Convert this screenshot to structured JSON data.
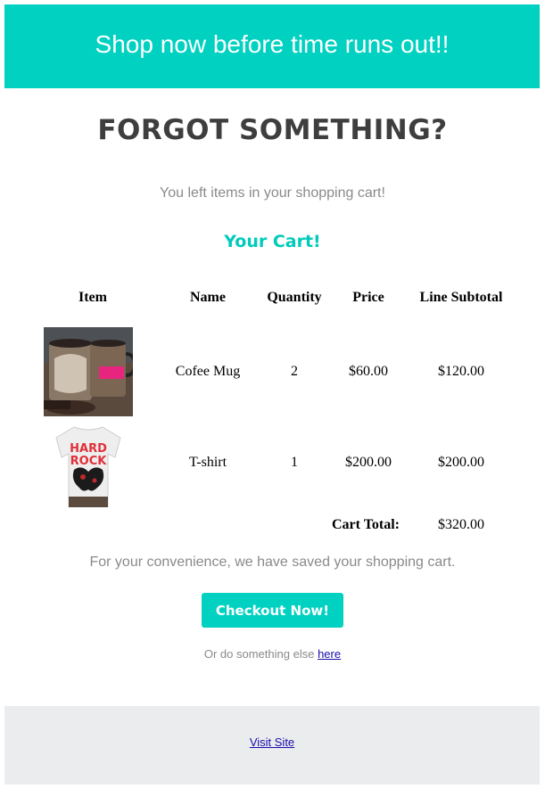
{
  "banner": {
    "text": "Shop now before time runs out!!"
  },
  "title": "FORGOT SOMETHING?",
  "subtitle": "You left items in your shopping cart!",
  "cart_heading": "Your Cart!",
  "table": {
    "headers": [
      "Item",
      "Name",
      "Quantity",
      "Price",
      "Line Subtotal"
    ],
    "rows": [
      {
        "name": "Cofee Mug",
        "quantity": "2",
        "price": "$60.00",
        "subtotal": "$120.00",
        "image": "coffee-mug-image"
      },
      {
        "name": "T-shirt",
        "quantity": "1",
        "price": "$200.00",
        "subtotal": "$200.00",
        "image": "tshirt-image"
      }
    ],
    "total_label": "Cart Total:",
    "total_value": "$320.00",
    "tshirt_print": [
      "HARD",
      "ROCK"
    ]
  },
  "convenience": "For your convenience, we have saved your shopping cart.",
  "checkout_label": "Checkout Now!",
  "else_prefix": "Or do something else",
  "else_link": "here",
  "footer_link": "Visit Site",
  "colors": {
    "accent": "#00d1c1",
    "heading": "#3e3e3e",
    "muted": "#8a8a8a",
    "footer_bg": "#ebecee"
  }
}
